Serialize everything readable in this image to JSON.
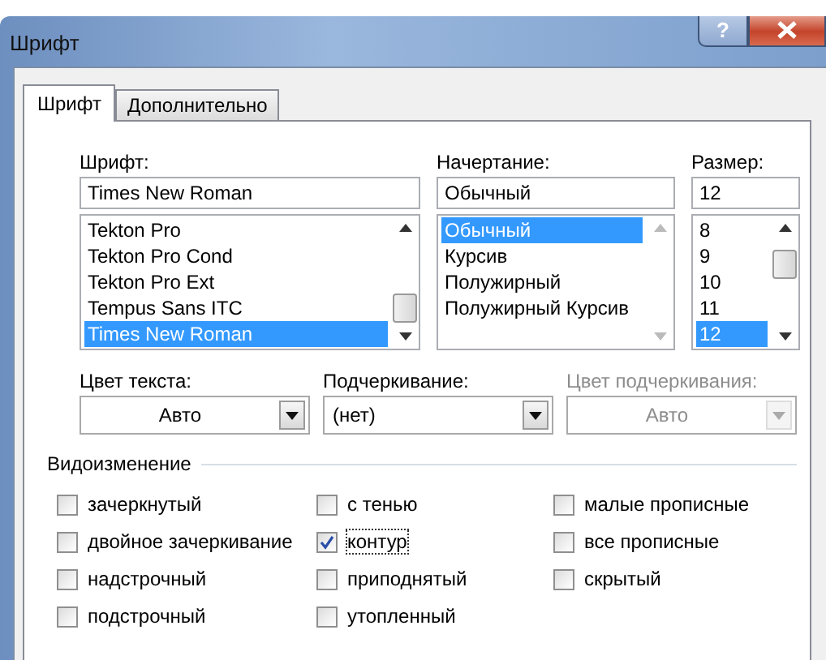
{
  "window": {
    "title": "Шрифт",
    "help": "?"
  },
  "tabs": [
    {
      "label": "Шрифт",
      "selected": true
    },
    {
      "label": "Дополнительно",
      "selected": false
    }
  ],
  "font": {
    "label": "Шрифт:",
    "value": "Times New Roman",
    "items": [
      {
        "label": "Tekton Pro",
        "selected": false
      },
      {
        "label": "Tekton Pro Cond",
        "selected": false
      },
      {
        "label": "Tekton Pro Ext",
        "selected": false
      },
      {
        "label": "Tempus Sans ITC",
        "selected": false
      },
      {
        "label": "Times New Roman",
        "selected": true
      }
    ]
  },
  "style": {
    "label": "Начертание:",
    "value": "Обычный",
    "items": [
      {
        "label": "Обычный",
        "selected": true
      },
      {
        "label": "Курсив",
        "selected": false
      },
      {
        "label": "Полужирный",
        "selected": false
      },
      {
        "label": "Полужирный Курсив",
        "selected": false
      }
    ]
  },
  "size": {
    "label": "Размер:",
    "value": "12",
    "items": [
      {
        "label": "8",
        "selected": false
      },
      {
        "label": "9",
        "selected": false
      },
      {
        "label": "10",
        "selected": false
      },
      {
        "label": "11",
        "selected": false
      },
      {
        "label": "12",
        "selected": true
      }
    ]
  },
  "dropdowns": [
    {
      "label": "Цвет текста:",
      "value": "Авто",
      "kind": "color",
      "disabled": false
    },
    {
      "label": "Подчеркивание:",
      "value": "(нет)",
      "kind": "list",
      "disabled": false
    },
    {
      "label": "Цвет подчеркивания:",
      "value": "Авто",
      "kind": "color",
      "disabled": true
    }
  ],
  "effects": {
    "title": "Видоизменение",
    "items": [
      {
        "label": "зачеркнутый",
        "checked": false,
        "focused": false
      },
      {
        "label": "с тенью",
        "checked": false,
        "focused": false
      },
      {
        "label": "малые прописные",
        "checked": false,
        "focused": false
      },
      {
        "label": "двойное зачеркивание",
        "checked": false,
        "focused": false
      },
      {
        "label": "контур",
        "checked": true,
        "focused": true
      },
      {
        "label": "все прописные",
        "checked": false,
        "focused": false
      },
      {
        "label": "надстрочный",
        "checked": false,
        "focused": false
      },
      {
        "label": "приподнятый",
        "checked": false,
        "focused": false
      },
      {
        "label": "скрытый",
        "checked": false,
        "focused": false
      },
      {
        "label": "подстрочный",
        "checked": false,
        "focused": false
      },
      {
        "label": "утопленный",
        "checked": false,
        "focused": false
      }
    ]
  }
}
